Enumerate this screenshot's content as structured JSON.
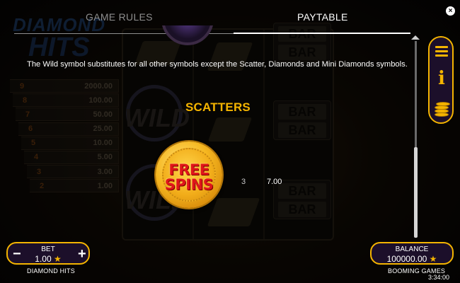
{
  "header": {
    "tabs": [
      {
        "label": "GAME RULES",
        "active": false
      },
      {
        "label": "PAYTABLE",
        "active": true
      }
    ],
    "close_icon": "close-icon",
    "close_glyph": "×"
  },
  "paytable": {
    "wild_description": "The Wild symbol substitutes for all other symbols except the Scatter, Diamonds and Mini Diamonds symbols.",
    "section_heading": "SCATTERS",
    "scatter_symbol": {
      "line1": "FREE",
      "line2": "SPINS"
    },
    "payouts": [
      {
        "count": "3",
        "value": "7.00"
      }
    ]
  },
  "side_menu": {
    "items": [
      {
        "icon": "hamburger-menu-icon"
      },
      {
        "icon": "info-icon",
        "glyph": "i"
      },
      {
        "icon": "coin-stack-icon"
      }
    ]
  },
  "bet": {
    "label": "BET",
    "value": "1.00",
    "currency_glyph": "★",
    "minus_glyph": "−",
    "plus_glyph": "+",
    "game_name": "DIAMOND HITS"
  },
  "balance": {
    "label": "BALANCE",
    "value": "100000.00",
    "currency_glyph": "★",
    "provider": "BOOMING GAMES"
  },
  "clock": "3:34:00",
  "background": {
    "logo_line1": "DIAMOND",
    "logo_line2": "HITS",
    "paytable_rows": [
      {
        "n": "9",
        "v": "2000.00"
      },
      {
        "n": "8",
        "v": "100.00"
      },
      {
        "n": "7",
        "v": "50.00"
      },
      {
        "n": "6",
        "v": "25.00"
      },
      {
        "n": "5",
        "v": "10.00"
      },
      {
        "n": "4",
        "v": "5.00"
      },
      {
        "n": "3",
        "v": "3.00"
      },
      {
        "n": "2",
        "v": "1.00"
      }
    ],
    "wild_label": "WILD",
    "bar_label": "BAR"
  },
  "colors": {
    "accent": "#f4b400",
    "panel": "#1c0f2a",
    "coin_text": "#e0151a"
  }
}
